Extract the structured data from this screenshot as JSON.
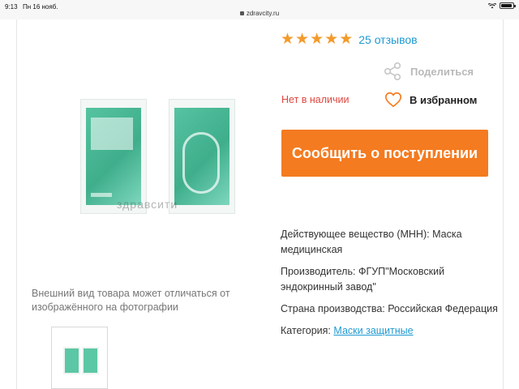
{
  "status_bar": {
    "time": "9:13",
    "date": "Пн 16 нояб.",
    "url": "zdravcity.ru",
    "battery_level": 0.9
  },
  "product": {
    "watermark": "здравсити",
    "disclaimer": "Внешний вид товара может отличаться от изображённого на фотографии",
    "rating": 5,
    "reviews_label": "25 отзывов",
    "share_label": "Поделиться",
    "stock_status": "Нет в наличии",
    "favorite_label": "В избранном",
    "notify_button": "Сообщить о поступлении",
    "attributes": [
      {
        "label": "Действующее вещество (МНН):",
        "value": "Маска медицинская"
      },
      {
        "label": "Производитель:",
        "value": "ФГУП\"Московский эндокринный завод\""
      },
      {
        "label": "Страна производства:",
        "value": "Российская Федерация"
      }
    ],
    "category": {
      "label": "Категория:",
      "value": "Маски защитные"
    }
  },
  "colors": {
    "accent_orange": "#f47b20",
    "star": "#f39a2b",
    "link": "#1f9ad1",
    "out_of_stock": "#e0473f"
  }
}
